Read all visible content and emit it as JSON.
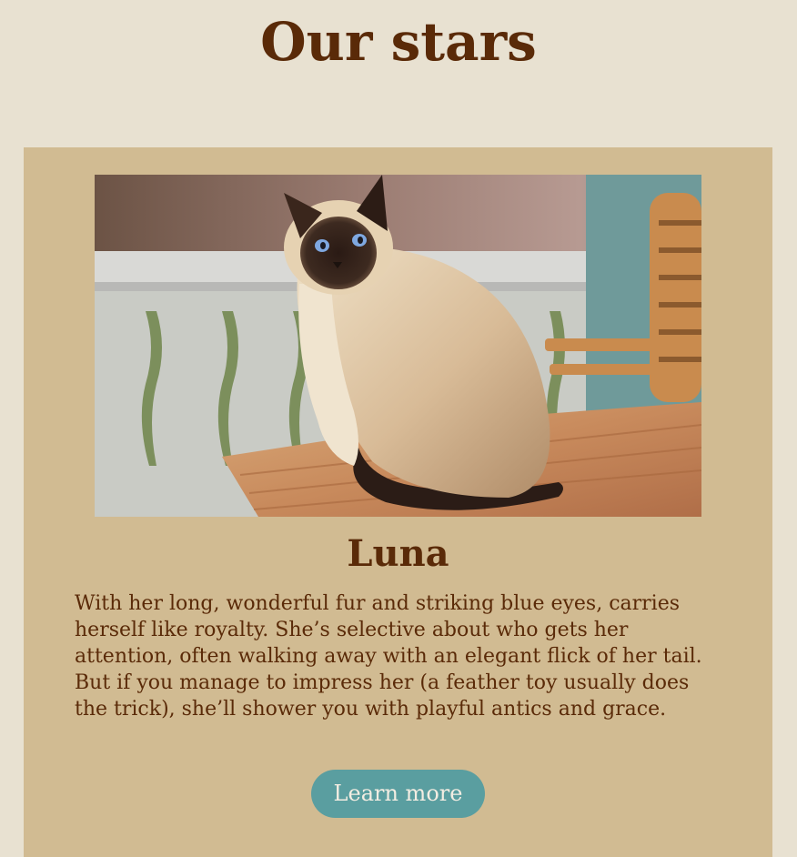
{
  "page": {
    "title": "Our stars"
  },
  "card": {
    "image_name": "siamese-cat-photo",
    "title": "Luna",
    "text": "With her long, wonderful fur and striking blue eyes, carries herself like royalty. She’s selective about who gets her attention, often walking away with an elegant flick of her tail. But if you manage to impress her (a feather toy usually does the trick), she’ll shower you with playful antics and grace.",
    "button_label": "Learn more"
  },
  "colors": {
    "page_background": "#e8e1d1",
    "card_background": "#d1bb92",
    "text": "#5a2a08",
    "button_background": "#5a9ea0",
    "button_text": "#f3ede2"
  }
}
